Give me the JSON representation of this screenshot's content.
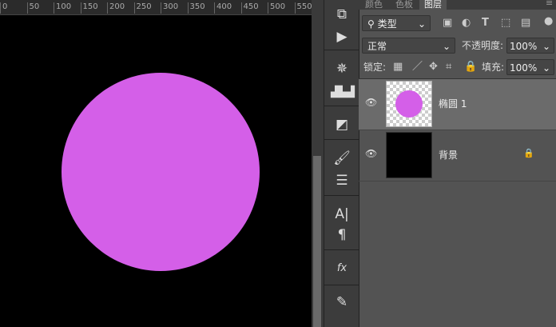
{
  "ruler": {
    "ticks": [
      "0",
      "50",
      "100",
      "150",
      "200",
      "250",
      "300",
      "350",
      "400",
      "450",
      "500",
      "550"
    ]
  },
  "canvas": {
    "background": "#000000",
    "circle_color": "#d45fe8"
  },
  "tools": [
    "history-icon",
    "play-icon",
    "navigator-icon",
    "histogram-icon",
    "3d-icon",
    "brush-icon",
    "adjust-icon",
    "character-icon",
    "paragraph-icon",
    "styles-icon",
    "brush-settings-icon"
  ],
  "panel": {
    "tabs": [
      "颜色",
      "色板",
      "图层"
    ],
    "active_tab": "图层",
    "filter": {
      "value": "类型"
    },
    "blend_mode": "正常",
    "opacity_label": "不透明度:",
    "opacity": "100%",
    "lock_label": "锁定:",
    "fill_label": "填充:",
    "fill": "100%",
    "layers": [
      {
        "name": "椭圆 1",
        "selected": true
      },
      {
        "name": "背景",
        "locked": true
      }
    ]
  }
}
